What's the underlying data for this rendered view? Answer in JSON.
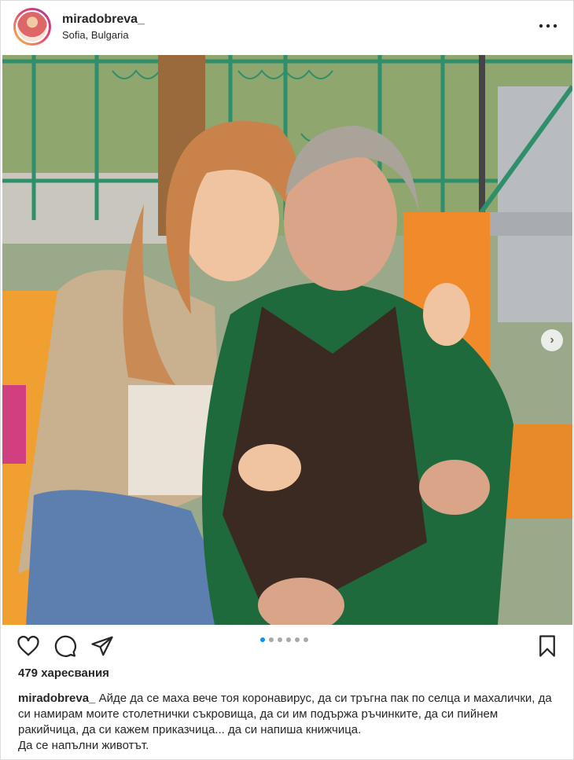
{
  "header": {
    "username": "miradobreva_",
    "location": "Sofia, Bulgaria",
    "more_icon": "more-horizontal-icon",
    "more_label": "•••"
  },
  "photo": {
    "next_icon": "chevron-right-icon",
    "next_label": "›"
  },
  "actions": {
    "like_icon": "heart-icon",
    "comment_icon": "comment-icon",
    "share_icon": "paper-plane-icon",
    "save_icon": "bookmark-icon",
    "carousel_count": 6,
    "carousel_active": 0
  },
  "likes": "479 харесвания",
  "caption": {
    "username": "miradobreva_",
    "text": "Айде да се маха вече тоя коронавирус, да си тръгна пак по селца и махалички, да си намирам моите столетнички съкровища, да си им подържа ръчинките, да си пийнем ракийчица, да си кажем приказчица... да си напиша книжчица.",
    "line2": "Да се напълни животът."
  },
  "colors": {
    "accent": "#0095f6",
    "text": "#262626",
    "border": "#dbdbdb"
  }
}
